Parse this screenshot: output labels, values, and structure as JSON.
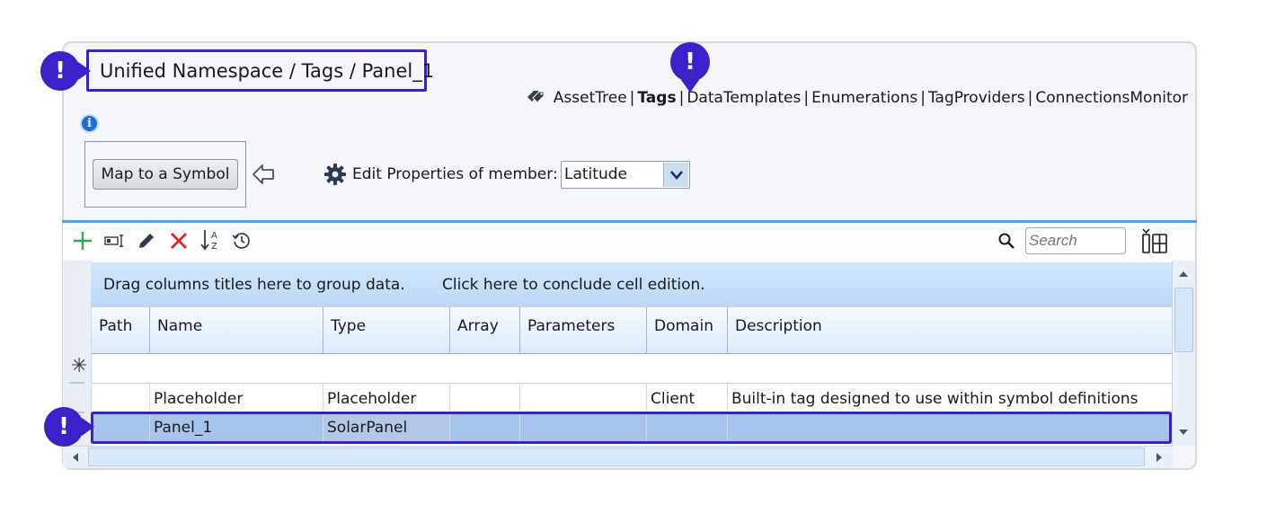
{
  "header": {
    "breadcrumb": "Unified Namespace / Tags / Panel_1",
    "nav": {
      "asset_tree": "AssetTree",
      "tags": "Tags",
      "data_templates": "DataTemplates",
      "enumerations": "Enumerations",
      "tag_providers": "TagProviders",
      "connections_monitor": "ConnectionsMonitor",
      "separator": "|"
    }
  },
  "markers": {
    "symbol": "!"
  },
  "info_icon_glyph": "i",
  "actions": {
    "map_button": "Map to a Symbol",
    "edit_properties_label": "Edit Properties of member:",
    "member_select_value": "Latitude"
  },
  "toolbar": {
    "search_placeholder": "Search",
    "icons": [
      "add-icon",
      "rename-icon",
      "edit-icon",
      "delete-icon",
      "sort-icon",
      "history-icon",
      "search-icon",
      "columns-icon"
    ]
  },
  "grid": {
    "group_hint": "Drag columns titles here to group data.",
    "conclude_hint": "Click here to conclude cell edition.",
    "new_row_glyph": "✳",
    "columns": [
      "Path",
      "Name",
      "Type",
      "Array",
      "Parameters",
      "Domain",
      "Description"
    ],
    "rows": [
      {
        "path": "",
        "name": "Placeholder",
        "type": "Placeholder",
        "array": "",
        "parameters": "",
        "domain": "Client",
        "description": "Built-in tag designed to use within symbol definitions"
      },
      {
        "path": "",
        "name": "Panel_1",
        "type": "SolarPanel",
        "array": "",
        "parameters": "",
        "domain": "",
        "description": "",
        "selected": true
      }
    ]
  },
  "colors": {
    "accent": "#3b21c9",
    "selection": "#a6c4ec",
    "divider": "#47a3ef"
  }
}
